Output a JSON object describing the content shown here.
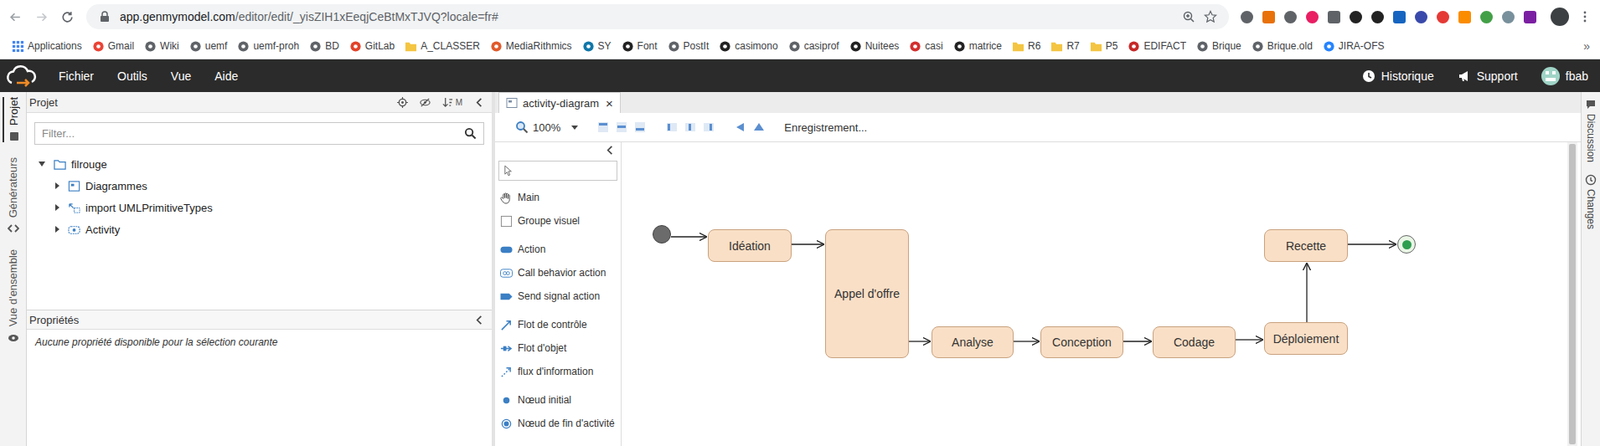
{
  "browser": {
    "url_host": "app.genmymodel.com",
    "url_path": "/editor/edit/_yisZIH1xEeqjCeBtMxTJVQ?locale=fr#",
    "bookmarks": [
      {
        "label": "Applications",
        "kind": "apps",
        "color": "#4285f4"
      },
      {
        "label": "Gmail",
        "kind": "site",
        "color": "#ea4335"
      },
      {
        "label": "Wiki",
        "kind": "site",
        "color": "#5f6368"
      },
      {
        "label": "uemf",
        "kind": "site",
        "color": "#5f6368"
      },
      {
        "label": "uemf-proh",
        "kind": "site",
        "color": "#5f6368"
      },
      {
        "label": "BD",
        "kind": "site",
        "color": "#5f6368"
      },
      {
        "label": "GitLab",
        "kind": "site",
        "color": "#e24329"
      },
      {
        "label": "A_CLASSER",
        "kind": "folder",
        "color": "#f4c542"
      },
      {
        "label": "MediaRithmics",
        "kind": "site",
        "color": "#e05a2b"
      },
      {
        "label": "SY",
        "kind": "site",
        "color": "#0e76a8"
      },
      {
        "label": "Font",
        "kind": "site",
        "color": "#222222"
      },
      {
        "label": "PostIt",
        "kind": "site",
        "color": "#5f6368"
      },
      {
        "label": "casimono",
        "kind": "site",
        "color": "#222222"
      },
      {
        "label": "casiprof",
        "kind": "site",
        "color": "#5f6368"
      },
      {
        "label": "Nuitees",
        "kind": "site",
        "color": "#222222"
      },
      {
        "label": "casi",
        "kind": "site",
        "color": "#d32f2f"
      },
      {
        "label": "matrice",
        "kind": "site",
        "color": "#222222"
      },
      {
        "label": "R6",
        "kind": "folder",
        "color": "#f4c542"
      },
      {
        "label": "R7",
        "kind": "folder",
        "color": "#f4c542"
      },
      {
        "label": "P5",
        "kind": "folder",
        "color": "#f4c542"
      },
      {
        "label": "EDIFACT",
        "kind": "site",
        "color": "#c62828"
      },
      {
        "label": "Brique",
        "kind": "site",
        "color": "#5f6368"
      },
      {
        "label": "Brique.old",
        "kind": "site",
        "color": "#5f6368"
      },
      {
        "label": "JIRA-OFS",
        "kind": "site",
        "color": "#2684ff"
      }
    ],
    "overflow": "»"
  },
  "app": {
    "menu": [
      "Fichier",
      "Outils",
      "Vue",
      "Aide"
    ],
    "history": "Historique",
    "support": "Support",
    "user": "fbab"
  },
  "left_rail": [
    {
      "label": "Projet",
      "selected": true
    },
    {
      "label": "Générateurs",
      "selected": false
    },
    {
      "label": "Vue d'ensemble",
      "selected": false
    }
  ],
  "project": {
    "title": "Projet",
    "badge": "M",
    "filter_placeholder": "Filter...",
    "tree": {
      "label": "filrouge",
      "expanded": true,
      "children": [
        {
          "label": "Diagrammes",
          "kind": "diagrams",
          "expanded": false
        },
        {
          "label": "import UMLPrimitiveTypes",
          "kind": "import",
          "expanded": false
        },
        {
          "label": "Activity",
          "kind": "activity",
          "expanded": false
        }
      ]
    }
  },
  "properties": {
    "title": "Propriétés",
    "empty": "Aucune propriété disponible pour la sélection courante"
  },
  "editor": {
    "tabs": [
      {
        "label": "activity-diagram",
        "close": "×",
        "selected": true
      }
    ],
    "zoom": "100%",
    "status": "Enregistrement..."
  },
  "palette": {
    "items": [
      {
        "label": "Main",
        "kind": "tool"
      },
      {
        "label": "Groupe visuel",
        "kind": "group"
      },
      {
        "label": "Action",
        "kind": "action"
      },
      {
        "label": "Call behavior action",
        "kind": "call"
      },
      {
        "label": "Send signal action",
        "kind": "signal"
      },
      {
        "label": "Flot de contrôle",
        "kind": "control-flow"
      },
      {
        "label": "Flot d'objet",
        "kind": "object-flow"
      },
      {
        "label": "flux d'information",
        "kind": "info-flow"
      },
      {
        "label": "Nœud initial",
        "kind": "initial"
      },
      {
        "label": "Nœud de fin d'activité",
        "kind": "final"
      }
    ]
  },
  "diagram": {
    "nodes": [
      {
        "kind": "initial"
      },
      {
        "kind": "action",
        "label": "Idéation"
      },
      {
        "kind": "action",
        "label": "Appel d'offre"
      },
      {
        "kind": "action",
        "label": "Analyse"
      },
      {
        "kind": "action",
        "label": "Conception"
      },
      {
        "kind": "action",
        "label": "Codage"
      },
      {
        "kind": "action",
        "label": "Déploiement"
      },
      {
        "kind": "action",
        "label": "Recette"
      },
      {
        "kind": "final"
      }
    ]
  },
  "right_rail": [
    {
      "label": "Discussion"
    },
    {
      "label": "Changes"
    }
  ]
}
